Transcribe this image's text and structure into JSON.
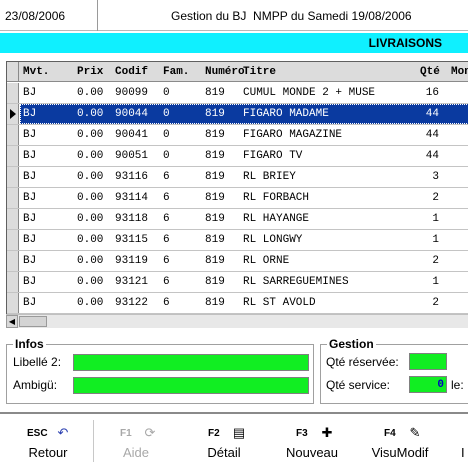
{
  "header": {
    "date": "23/08/2006",
    "title": "Gestion du BJ  NMPP du Samedi 19/08/2006"
  },
  "banner": {
    "label": "LIVRAISONS"
  },
  "grid": {
    "columns": [
      "Mvt.",
      "Prix",
      "Codif",
      "Fam.",
      "Numéro",
      "Titre",
      "Qté",
      "Mon"
    ],
    "rows": [
      {
        "mvt": "BJ",
        "prix": "0.00",
        "codif": "90099",
        "fam": "0",
        "num": "819",
        "titre": "CUMUL MONDE 2 + MUSE",
        "qte": "16"
      },
      {
        "mvt": "BJ",
        "prix": "0.00",
        "codif": "90044",
        "fam": "0",
        "num": "819",
        "titre": "FIGARO MADAME",
        "qte": "44"
      },
      {
        "mvt": "BJ",
        "prix": "0.00",
        "codif": "90041",
        "fam": "0",
        "num": "819",
        "titre": "FIGARO MAGAZINE",
        "qte": "44"
      },
      {
        "mvt": "BJ",
        "prix": "0.00",
        "codif": "90051",
        "fam": "0",
        "num": "819",
        "titre": "FIGARO TV",
        "qte": "44"
      },
      {
        "mvt": "BJ",
        "prix": "0.00",
        "codif": "93116",
        "fam": "6",
        "num": "819",
        "titre": "RL BRIEY",
        "qte": "3"
      },
      {
        "mvt": "BJ",
        "prix": "0.00",
        "codif": "93114",
        "fam": "6",
        "num": "819",
        "titre": "RL FORBACH",
        "qte": "2"
      },
      {
        "mvt": "BJ",
        "prix": "0.00",
        "codif": "93118",
        "fam": "6",
        "num": "819",
        "titre": "RL HAYANGE",
        "qte": "1"
      },
      {
        "mvt": "BJ",
        "prix": "0.00",
        "codif": "93115",
        "fam": "6",
        "num": "819",
        "titre": "RL LONGWY",
        "qte": "1"
      },
      {
        "mvt": "BJ",
        "prix": "0.00",
        "codif": "93119",
        "fam": "6",
        "num": "819",
        "titre": "RL ORNE",
        "qte": "2"
      },
      {
        "mvt": "BJ",
        "prix": "0.00",
        "codif": "93121",
        "fam": "6",
        "num": "819",
        "titre": "RL SARREGUEMINES",
        "qte": "1"
      },
      {
        "mvt": "BJ",
        "prix": "0.00",
        "codif": "93122",
        "fam": "6",
        "num": "819",
        "titre": "RL ST AVOLD",
        "qte": "2"
      }
    ],
    "selected_row": 1
  },
  "infos": {
    "title": "Infos",
    "libelle_label": "Libellé 2:",
    "libelle_value": "",
    "ambigu_label": "Ambigü:",
    "ambigu_value": ""
  },
  "gestion": {
    "title": "Gestion",
    "qte_reservee_label": "Qté réservée:",
    "qte_reservee_value": "",
    "qte_service_label": "Qté service:",
    "qte_service_value": "0",
    "extra_label": "le:"
  },
  "toolbar": {
    "buttons": [
      {
        "key": "ESC",
        "label": "Retour",
        "icon": "undo-icon",
        "glyph": "↶"
      },
      {
        "key": "F1",
        "label": "Aide",
        "icon": "help-icon",
        "glyph": "⟳"
      },
      {
        "key": "F2",
        "label": "Détail",
        "icon": "detail-icon",
        "glyph": "▤"
      },
      {
        "key": "F3",
        "label": "Nouveau",
        "icon": "new-icon",
        "glyph": "✚"
      },
      {
        "key": "F4",
        "label": "VisuModif",
        "icon": "edit-icon",
        "glyph": "✎"
      },
      {
        "key": "",
        "label": "I",
        "icon": "",
        "glyph": ""
      }
    ]
  },
  "colors": {
    "banner": "#0ff0ff",
    "selection": "#0a3aa0",
    "field_green": "#11ee22"
  }
}
